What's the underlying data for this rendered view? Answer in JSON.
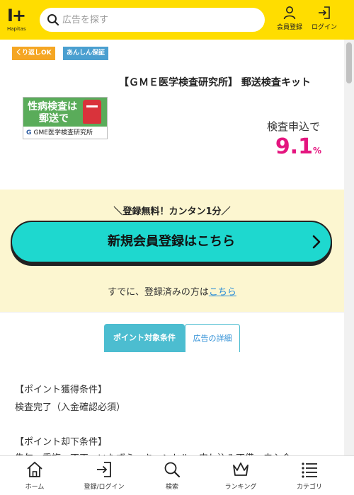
{
  "header": {
    "logo_text": "Hapitas",
    "search_placeholder": "広告を探す",
    "register_label": "会員登録",
    "login_label": "ログイン"
  },
  "badges": [
    "くり返しOK",
    "あんしん保証"
  ],
  "product": {
    "title": "【ＧＭＥ医学検査研究所】 郵送検査キット",
    "image_line1": "性病検査は",
    "image_line2": "郵送で",
    "image_brand": "GME医学検査研究所",
    "reward_label": "検査申込で",
    "reward_value": "9.1",
    "reward_unit": "%"
  },
  "registration": {
    "catch": "＼登録無料！カンタン1分／",
    "button_label": "新規会員登録はこちら",
    "login_prompt": "すでに、登録済みの方は",
    "login_link": "こちら"
  },
  "tabs": [
    "ポイント対象条件",
    "広告の詳細"
  ],
  "conditions": {
    "heading1": "【ポイント獲得条件】",
    "text1": "検査完了（入金確認必須）",
    "heading2": "【ポイント却下条件】",
    "text2": "告欠、重複、不正・いたずら、キャンセル、申し込み不備、未入金"
  },
  "bottom_nav": [
    "ホーム",
    "登録/ログイン",
    "検索",
    "ランキング",
    "カテゴリ"
  ],
  "colors": {
    "header": "#ffdd00",
    "register_button": "#1ed8cf",
    "reward": "#e4157f",
    "tab_active": "#4cbdd0",
    "link": "#2f8fd6"
  }
}
